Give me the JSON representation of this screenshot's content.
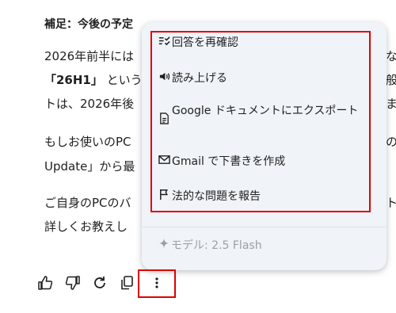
{
  "article": {
    "heading": "補足：今後の予定",
    "line1_start": "2026年前半には",
    "line1_end": "な",
    "line2_bold": "「26H1」",
    "line2_rest": "という",
    "line2_end": "般",
    "line3_start": "トは、2026年後",
    "line3_end": "ま",
    "line4_start": "もしお使いのPC",
    "line4_end": "の",
    "line5_start": "Update」から最",
    "line6_start": "ご自身のPCのバ",
    "line6_end": "ト",
    "line7_start": "詳しくお教えし"
  },
  "menu": {
    "items": [
      {
        "label": "回答を再確認",
        "icon": "double-check-icon"
      },
      {
        "label": "読み上げる",
        "icon": "speaker-icon"
      },
      {
        "label": "Google ドキュメントにエクスポート",
        "icon": "document-icon"
      },
      {
        "label": "Gmail で下書きを作成",
        "icon": "gmail-icon"
      },
      {
        "label": "法的な問題を報告",
        "icon": "flag-icon"
      }
    ],
    "model_label": "モデル: 2.5 Flash"
  },
  "actions": [
    "thumb-up-icon",
    "thumb-down-icon",
    "refresh-icon",
    "copy-icon",
    "more-vert-icon"
  ],
  "colors": {
    "menu_bg": "#f0f4f9",
    "highlight": "#e00000",
    "muted": "#9aa0a6"
  }
}
